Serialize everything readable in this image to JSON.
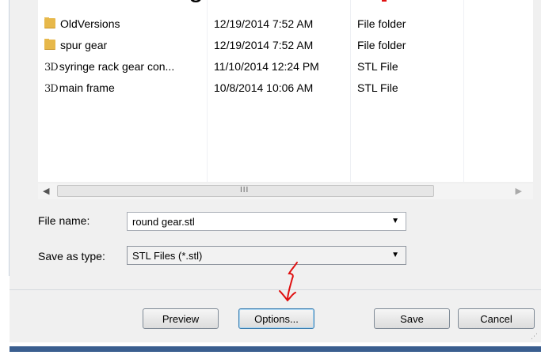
{
  "overlay_text": "g",
  "file_list": {
    "rows": [
      {
        "icon": "folder-icon",
        "name": "OldVersions",
        "date": "12/19/2014 7:52 AM",
        "type": "File folder"
      },
      {
        "icon": "folder-icon",
        "name": "spur gear",
        "date": "12/19/2014 7:52 AM",
        "type": "File folder"
      },
      {
        "icon": "stl-3d-icon",
        "icon_text": "3D",
        "name": "syringe rack gear con...",
        "date": "11/10/2014 12:24 PM",
        "type": "STL File"
      },
      {
        "icon": "stl-3d-icon",
        "icon_text": "3D",
        "name": "main frame",
        "date": "10/8/2014 10:06 AM",
        "type": "STL File"
      }
    ]
  },
  "scrollbar": {
    "left_arrow": "◀",
    "right_arrow": "▶",
    "grip": "III"
  },
  "form": {
    "file_name_label": "File name:",
    "file_name_value": "round gear.stl",
    "save_type_label": "Save as type:",
    "save_type_value": "STL Files (*.stl)",
    "dropdown_caret": "▼"
  },
  "buttons": {
    "preview": "Preview",
    "options": "Options...",
    "save": "Save",
    "cancel": "Cancel"
  },
  "colors": {
    "annotation_red": "#e01010",
    "status_bar": "#3a5e8f",
    "dialog_bg": "#f0f0f0"
  }
}
